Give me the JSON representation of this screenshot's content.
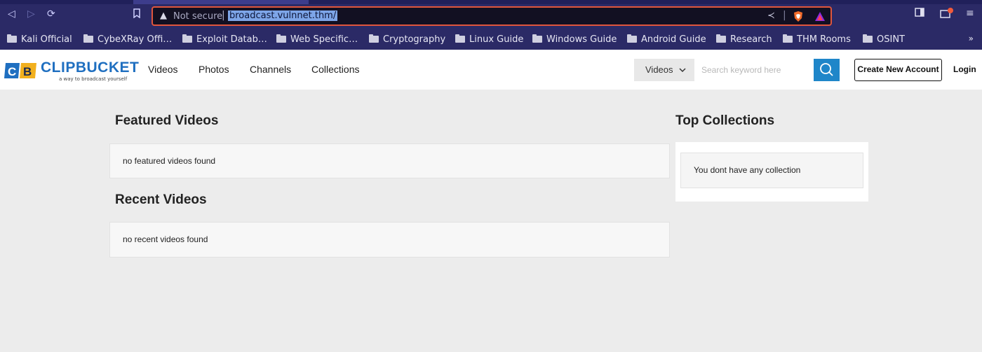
{
  "browser": {
    "security_label": "Not secure",
    "url": "broadcast.vulnnet.thm/",
    "bookmarks": [
      {
        "label": "Kali Official",
        "icon": "kali-dragon-icon"
      },
      {
        "label": "CybeXRay Offi…",
        "icon": "folder-icon"
      },
      {
        "label": "Exploit Datab…",
        "icon": "folder-icon"
      },
      {
        "label": "Web Specific…",
        "icon": "folder-icon"
      },
      {
        "label": "Cryptography",
        "icon": "folder-icon"
      },
      {
        "label": "Linux Guide",
        "icon": "folder-icon"
      },
      {
        "label": "Windows Guide",
        "icon": "folder-icon"
      },
      {
        "label": "Android Guide",
        "icon": "folder-icon"
      },
      {
        "label": "Research",
        "icon": "folder-icon"
      },
      {
        "label": "THM Rooms",
        "icon": "folder-icon"
      },
      {
        "label": "OSINT",
        "icon": "folder-icon"
      }
    ],
    "more_label": "»",
    "accent_color": "#e0563d",
    "bar_color": "#2b2a66"
  },
  "site": {
    "logo_letters": "CB",
    "logo_word": "CLIPBUCKET",
    "tagline": "a way to broadcast yourself",
    "nav": [
      "Videos",
      "Photos",
      "Channels",
      "Collections"
    ],
    "search": {
      "category": "Videos",
      "placeholder": "Search keyword here",
      "value": ""
    },
    "create_account": "Create New Account",
    "login": "Login",
    "brand_color": "#1f86c9"
  },
  "main": {
    "featured_title": "Featured Videos",
    "featured_empty": "no featured videos found",
    "recent_title": "Recent Videos",
    "recent_empty": "no recent videos found"
  },
  "sidebar": {
    "collections_title": "Top Collections",
    "collections_empty": "You dont have any collection"
  }
}
